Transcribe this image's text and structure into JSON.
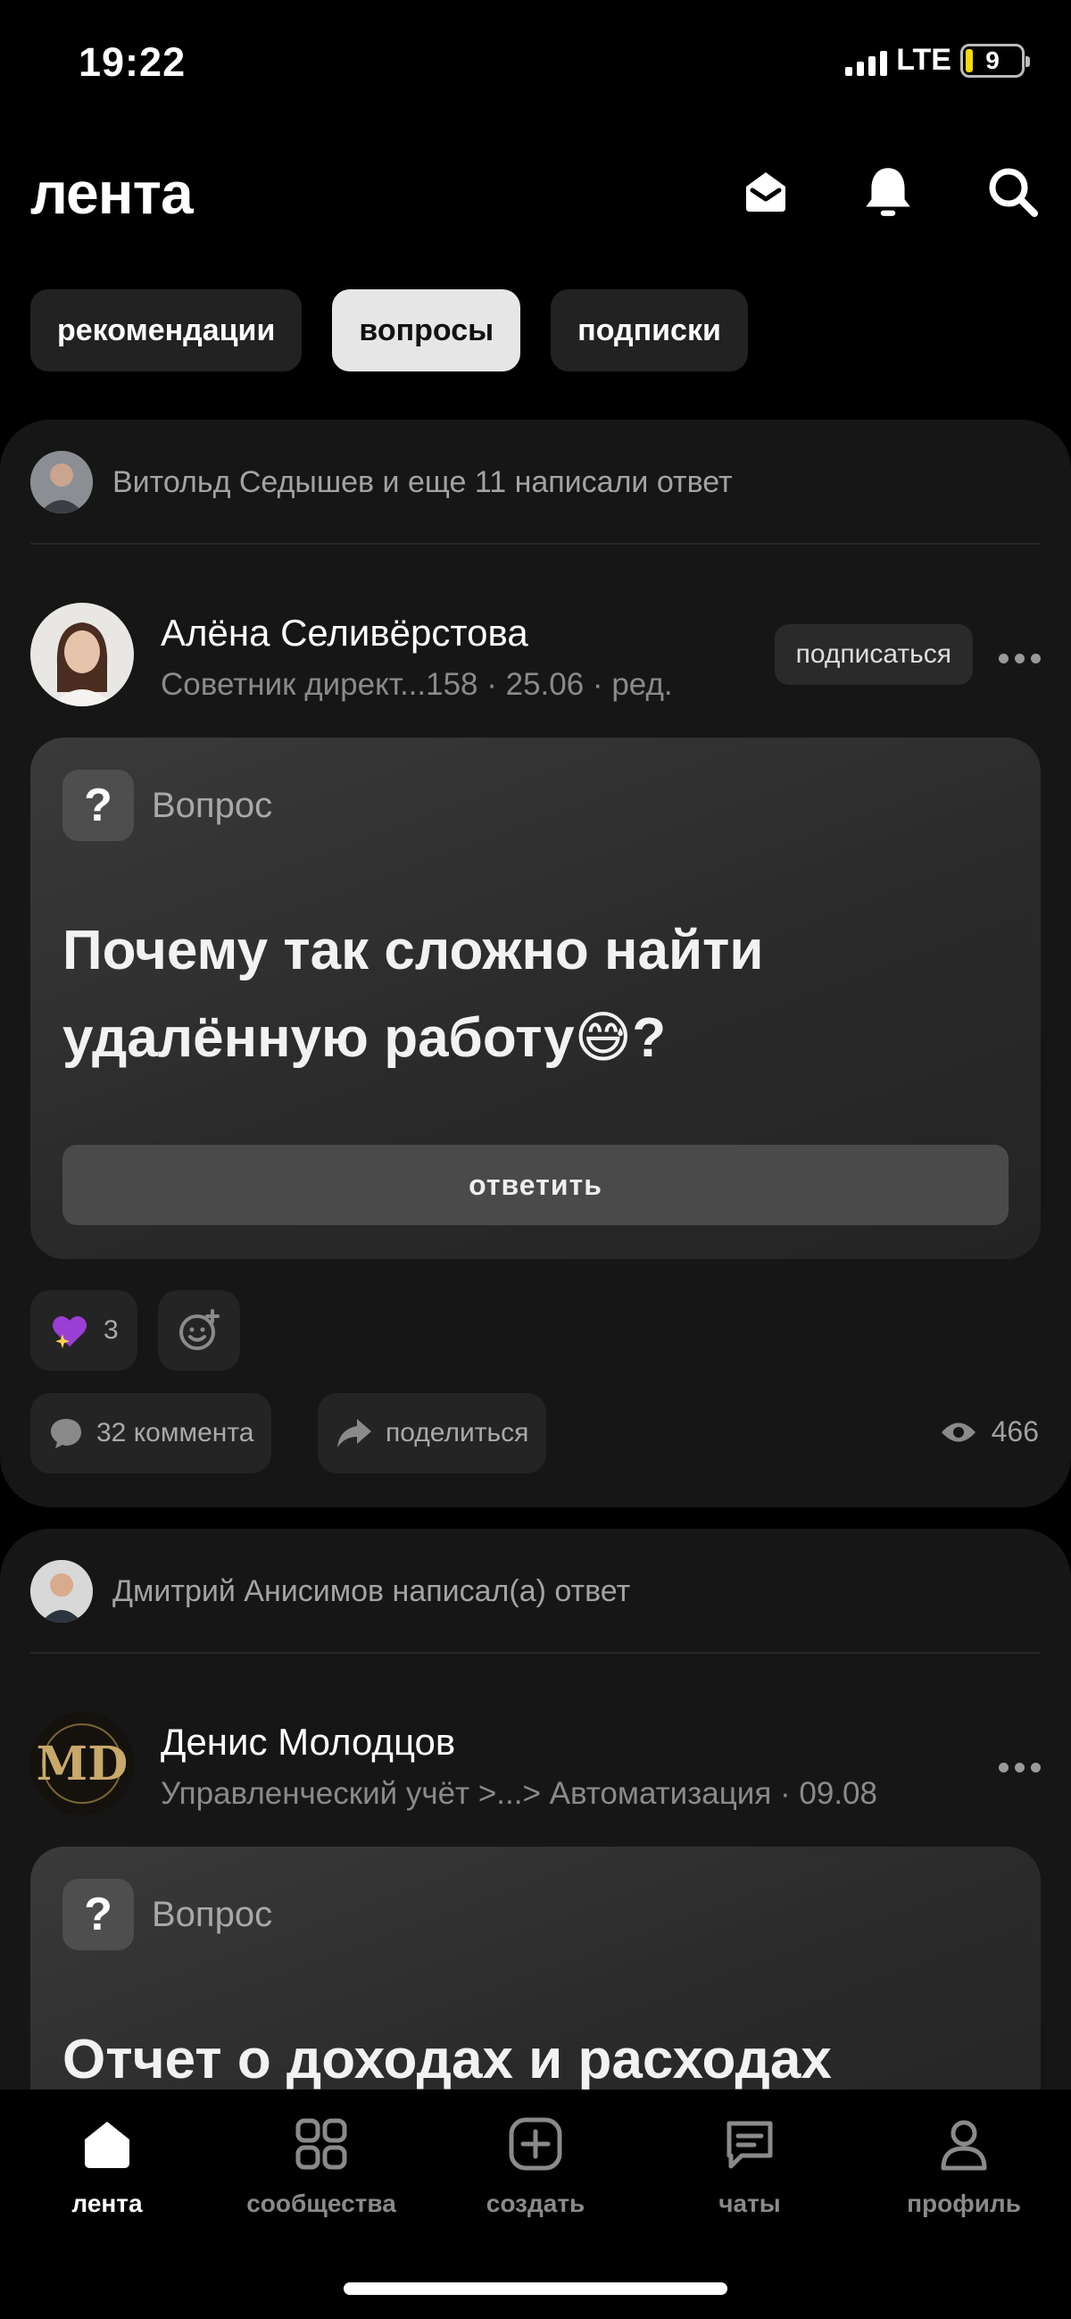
{
  "status": {
    "time": "19:22",
    "network": "LTE",
    "battery": "9"
  },
  "header": {
    "title": "лента"
  },
  "chips": [
    "рекомендации",
    "вопросы",
    "подписки"
  ],
  "posts": [
    {
      "activity": "Витольд Седышев и еще 11 написали ответ",
      "author": "Алёна Селивёрстова",
      "meta": "Советник директ...158 · 25.06 · ред.",
      "subscribe": "подписаться",
      "label": "Вопрос",
      "title": "Почему так сложно найти удалённую работу😅?",
      "answer": "ответить",
      "reaction_count": "3",
      "comments": "32 коммента",
      "share": "поделиться",
      "views": "466"
    },
    {
      "activity": "Дмитрий Анисимов написал(а) ответ",
      "author": "Денис Молодцов",
      "meta": "Управленческий учёт >...> Автоматизация · 09.08",
      "label": "Вопрос",
      "title": "Отчет о доходах и расходах"
    }
  ],
  "tabs": [
    "лента",
    "сообщества",
    "создать",
    "чаты",
    "профиль"
  ]
}
